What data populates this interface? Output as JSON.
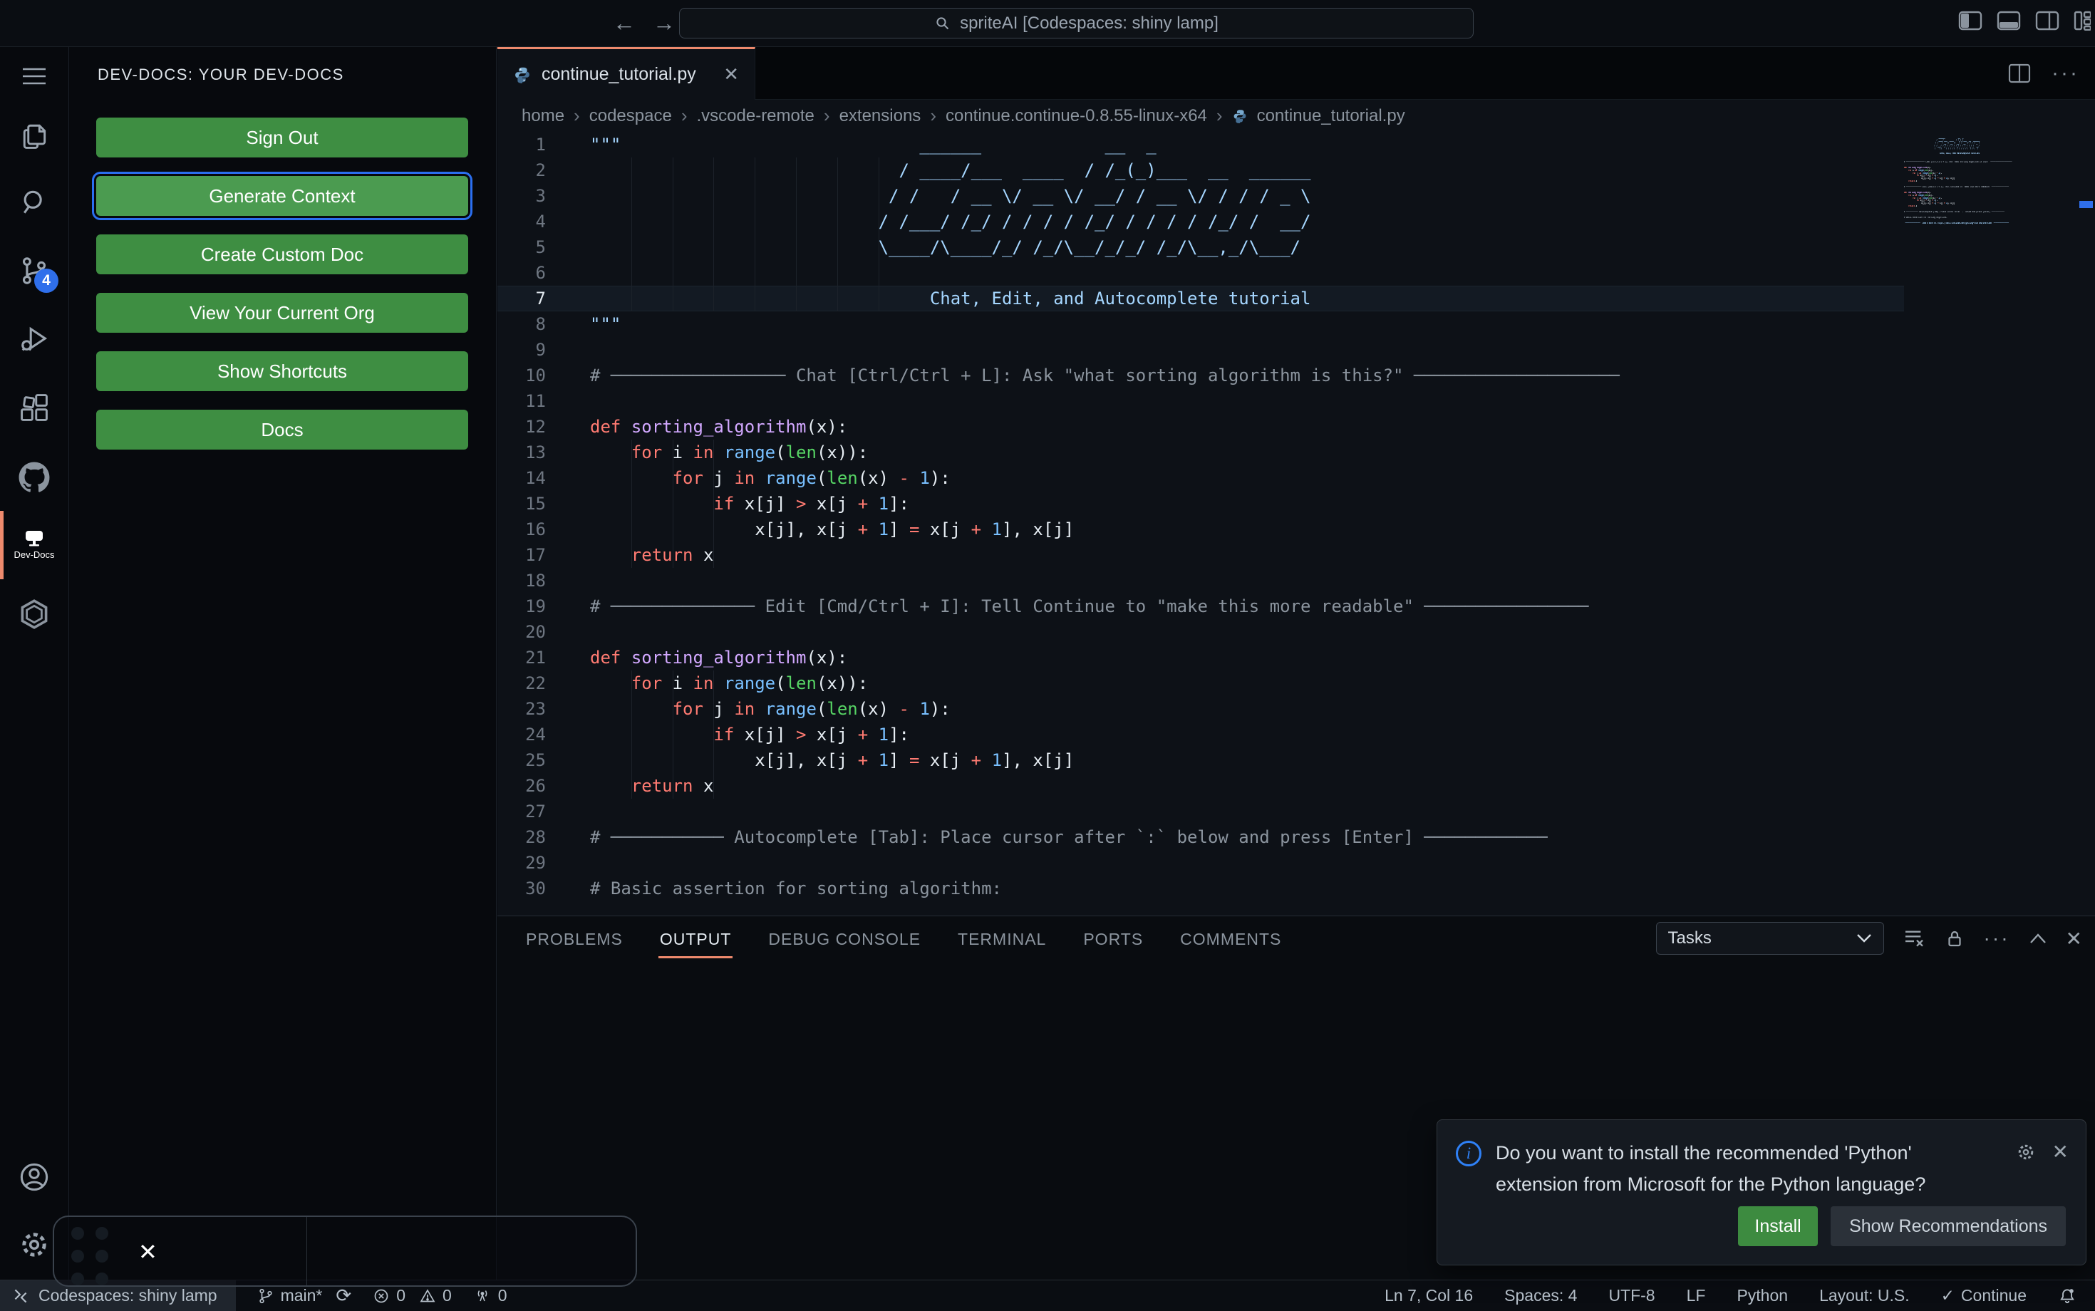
{
  "titlebar": {
    "search_value": "spriteAI [Codespaces: shiny lamp]"
  },
  "activity_bar": {
    "scm_badge": "4",
    "devdocs_label": "Dev-Docs"
  },
  "sidebar": {
    "title": "DEV-DOCS: YOUR DEV-DOCS",
    "buttons": [
      {
        "label": "Sign Out"
      },
      {
        "label": "Generate Context",
        "focused": true
      },
      {
        "label": "Create Custom Doc"
      },
      {
        "label": "View Your Current Org"
      },
      {
        "label": "Show Shortcuts"
      },
      {
        "label": "Docs"
      }
    ]
  },
  "editor": {
    "tab_label": "continue_tutorial.py",
    "breadcrumbs": [
      "home",
      "codespace",
      ".vscode-remote",
      "extensions",
      "continue.continue-0.8.55-linux-x64",
      "continue_tutorial.py"
    ],
    "active_line": 7,
    "lines": [
      {
        "n": 1,
        "seg": [
          [
            "s",
            "\"\"\"                             ______            __  _"
          ]
        ]
      },
      {
        "n": 2,
        "seg": [
          [
            "s",
            "                              / ____/___  ____  / /_(_)___  __  ______"
          ]
        ]
      },
      {
        "n": 3,
        "seg": [
          [
            "s",
            "                             / /   / __ \\/ __ \\/ __/ / __ \\/ / / / _ \\"
          ]
        ]
      },
      {
        "n": 4,
        "seg": [
          [
            "s",
            "                            / /___/ /_/ / / / / /_/ / / / / /_/ /  __/"
          ]
        ]
      },
      {
        "n": 5,
        "seg": [
          [
            "s",
            "                            \\____/\\____/_/ /_/\\__/_/_/ /_/\\__,_/\\___/"
          ]
        ]
      },
      {
        "n": 6,
        "seg": []
      },
      {
        "n": 7,
        "seg": [
          [
            "s",
            "                                 Chat, Edit, and Autocomplete tutorial"
          ]
        ]
      },
      {
        "n": 8,
        "seg": [
          [
            "s",
            "\"\"\""
          ]
        ]
      },
      {
        "n": 9,
        "seg": []
      },
      {
        "n": 10,
        "seg": [
          [
            "c",
            "# ───────────────── Chat [Ctrl/Ctrl + L]: Ask \"what sorting algorithm is this?\" ────────────────────"
          ]
        ]
      },
      {
        "n": 11,
        "seg": []
      },
      {
        "n": 12,
        "seg": [
          [
            "k",
            "def"
          ],
          [
            "p",
            " "
          ],
          [
            "f",
            "sorting_algorithm"
          ],
          [
            "p",
            "(x):"
          ]
        ]
      },
      {
        "n": 13,
        "seg": [
          [
            "p",
            "    "
          ],
          [
            "k",
            "for"
          ],
          [
            "p",
            " i "
          ],
          [
            "k",
            "in"
          ],
          [
            "p",
            " "
          ],
          [
            "b",
            "range"
          ],
          [
            "p",
            "("
          ],
          [
            "g",
            "len"
          ],
          [
            "p",
            "(x)):"
          ]
        ]
      },
      {
        "n": 14,
        "seg": [
          [
            "p",
            "        "
          ],
          [
            "k",
            "for"
          ],
          [
            "p",
            " j "
          ],
          [
            "k",
            "in"
          ],
          [
            "p",
            " "
          ],
          [
            "b",
            "range"
          ],
          [
            "p",
            "("
          ],
          [
            "g",
            "len"
          ],
          [
            "p",
            "(x) "
          ],
          [
            "k",
            "-"
          ],
          [
            "p",
            " "
          ],
          [
            "n",
            "1"
          ],
          [
            "p",
            "):"
          ]
        ]
      },
      {
        "n": 15,
        "seg": [
          [
            "p",
            "            "
          ],
          [
            "k",
            "if"
          ],
          [
            "p",
            " x[j] "
          ],
          [
            "k",
            ">"
          ],
          [
            "p",
            " x[j "
          ],
          [
            "k",
            "+"
          ],
          [
            "p",
            " "
          ],
          [
            "n",
            "1"
          ],
          [
            "p",
            "]:"
          ]
        ]
      },
      {
        "n": 16,
        "seg": [
          [
            "p",
            "                x[j], x[j "
          ],
          [
            "k",
            "+"
          ],
          [
            "p",
            " "
          ],
          [
            "n",
            "1"
          ],
          [
            "p",
            "] "
          ],
          [
            "k",
            "="
          ],
          [
            "p",
            " x[j "
          ],
          [
            "k",
            "+"
          ],
          [
            "p",
            " "
          ],
          [
            "n",
            "1"
          ],
          [
            "p",
            "], x[j]"
          ]
        ]
      },
      {
        "n": 17,
        "seg": [
          [
            "p",
            "    "
          ],
          [
            "k",
            "return"
          ],
          [
            "p",
            " x"
          ]
        ]
      },
      {
        "n": 18,
        "seg": []
      },
      {
        "n": 19,
        "seg": [
          [
            "c",
            "# ────────────── Edit [Cmd/Ctrl + I]: Tell Continue to \"make this more readable\" ────────────────"
          ]
        ]
      },
      {
        "n": 20,
        "seg": []
      },
      {
        "n": 21,
        "seg": [
          [
            "k",
            "def"
          ],
          [
            "p",
            " "
          ],
          [
            "f",
            "sorting_algorithm"
          ],
          [
            "p",
            "(x):"
          ]
        ]
      },
      {
        "n": 22,
        "seg": [
          [
            "p",
            "    "
          ],
          [
            "k",
            "for"
          ],
          [
            "p",
            " i "
          ],
          [
            "k",
            "in"
          ],
          [
            "p",
            " "
          ],
          [
            "b",
            "range"
          ],
          [
            "p",
            "("
          ],
          [
            "g",
            "len"
          ],
          [
            "p",
            "(x)):"
          ]
        ]
      },
      {
        "n": 23,
        "seg": [
          [
            "p",
            "        "
          ],
          [
            "k",
            "for"
          ],
          [
            "p",
            " j "
          ],
          [
            "k",
            "in"
          ],
          [
            "p",
            " "
          ],
          [
            "b",
            "range"
          ],
          [
            "p",
            "("
          ],
          [
            "g",
            "len"
          ],
          [
            "p",
            "(x) "
          ],
          [
            "k",
            "-"
          ],
          [
            "p",
            " "
          ],
          [
            "n",
            "1"
          ],
          [
            "p",
            "):"
          ]
        ]
      },
      {
        "n": 24,
        "seg": [
          [
            "p",
            "            "
          ],
          [
            "k",
            "if"
          ],
          [
            "p",
            " x[j] "
          ],
          [
            "k",
            ">"
          ],
          [
            "p",
            " x[j "
          ],
          [
            "k",
            "+"
          ],
          [
            "p",
            " "
          ],
          [
            "n",
            "1"
          ],
          [
            "p",
            "]:"
          ]
        ]
      },
      {
        "n": 25,
        "seg": [
          [
            "p",
            "                x[j], x[j "
          ],
          [
            "k",
            "+"
          ],
          [
            "p",
            " "
          ],
          [
            "n",
            "1"
          ],
          [
            "p",
            "] "
          ],
          [
            "k",
            "="
          ],
          [
            "p",
            " x[j "
          ],
          [
            "k",
            "+"
          ],
          [
            "p",
            " "
          ],
          [
            "n",
            "1"
          ],
          [
            "p",
            "], x[j]"
          ]
        ]
      },
      {
        "n": 26,
        "seg": [
          [
            "p",
            "    "
          ],
          [
            "k",
            "return"
          ],
          [
            "p",
            " x"
          ]
        ]
      },
      {
        "n": 27,
        "seg": []
      },
      {
        "n": 28,
        "seg": [
          [
            "c",
            "# ─────────── Autocomplete [Tab]: Place cursor after `:` below and press [Enter] ────────────"
          ]
        ]
      },
      {
        "n": 29,
        "seg": []
      },
      {
        "n": 30,
        "seg": [
          [
            "c",
            "# Basic assertion for sorting algorithm:"
          ]
        ]
      }
    ]
  },
  "minimap": {
    "extra_lines": [
      {
        "seg": []
      },
      {
        "seg": [
          [
            "s",
            "\"──────────────  Learn more at https://docs.continue.dev/getting-started/overview  ──────────────\""
          ]
        ]
      }
    ]
  },
  "panel": {
    "tabs": [
      "PROBLEMS",
      "OUTPUT",
      "DEBUG CONSOLE",
      "TERMINAL",
      "PORTS",
      "COMMENTS"
    ],
    "active_tab": "OUTPUT",
    "tasks_dropdown": "Tasks"
  },
  "notification": {
    "message": "Do you want to install the recommended 'Python' extension from Microsoft for the Python language?",
    "install_label": "Install",
    "show_recommendations_label": "Show Recommendations"
  },
  "status_bar": {
    "remote": "Codespaces: shiny lamp",
    "branch": "main*",
    "errors": "0",
    "warnings": "0",
    "ports": "0",
    "line_col": "Ln 7, Col 16",
    "spaces": "Spaces: 4",
    "encoding": "UTF-8",
    "eol": "LF",
    "language": "Python",
    "layout": "Layout: U.S.",
    "continue_label": "Continue"
  },
  "colors": {
    "accent_salmon": "#ee8a6d",
    "button_green": "#3e8e42",
    "badge_blue": "#2f6feb",
    "info_blue": "#2f81f7"
  }
}
